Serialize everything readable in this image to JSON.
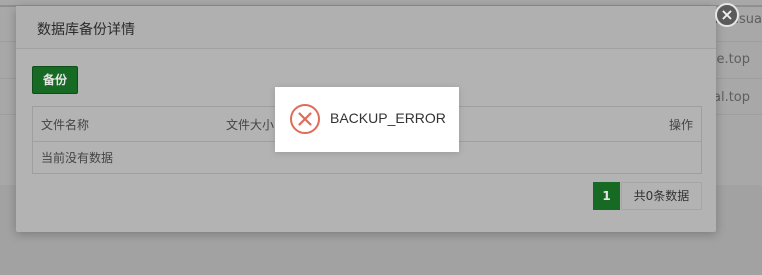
{
  "background": {
    "rows": [
      {
        "text": "revisua"
      },
      {
        "text": "ne.top"
      },
      {
        "text": "al.top"
      }
    ]
  },
  "modal": {
    "title": "数据库备份详情",
    "backup_label": "备份",
    "table": {
      "headers": [
        "文件名称",
        "文件大小",
        "操作"
      ],
      "empty_text": "当前没有数据"
    },
    "pagination": {
      "current_page": "1",
      "total_text": "共0条数据"
    },
    "close_icon": "close-icon"
  },
  "toast": {
    "message": "BACKUP_ERROR",
    "icon": "error-circle-icon",
    "icon_color": "#e06b57"
  },
  "colors": {
    "primary": "#166a24",
    "overlay": "#a8a8a8"
  }
}
